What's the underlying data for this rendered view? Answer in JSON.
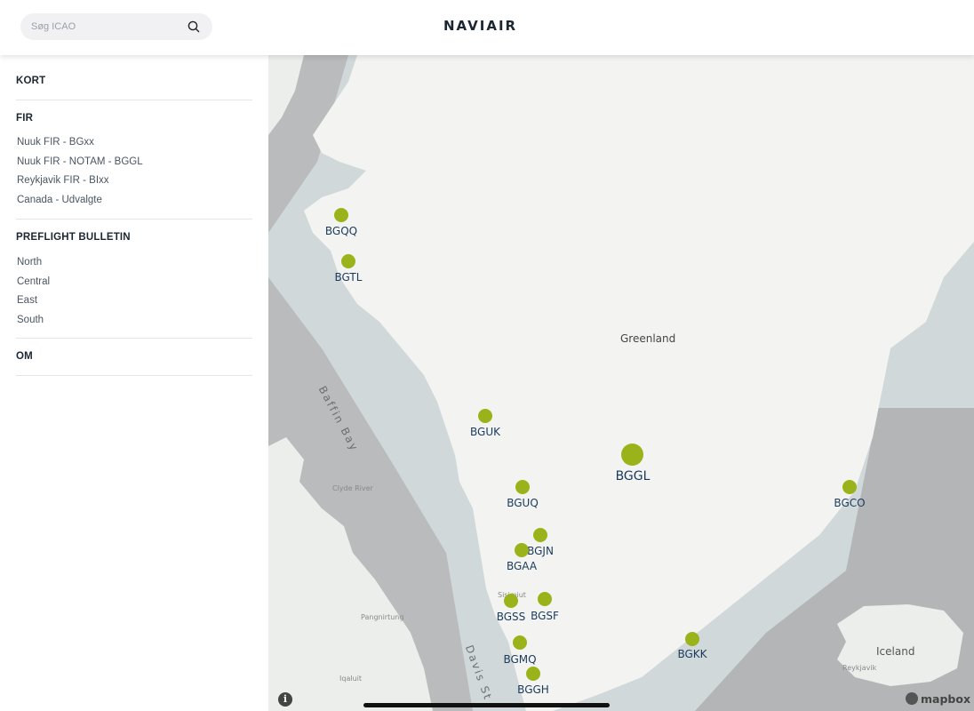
{
  "header": {
    "search_placeholder": "Søg ICAO",
    "logo": "NAVIAIR"
  },
  "sidebar": {
    "kort": "KORT",
    "fir": {
      "title": "FIR",
      "items": [
        "Nuuk FIR - BGxx",
        "Nuuk FIR - NOTAM - BGGL",
        "Reykjavik FIR - BIxx",
        "Canada - Udvalgte"
      ]
    },
    "preflight": {
      "title": "PREFLIGHT BULLETIN",
      "items": [
        "North",
        "Central",
        "East",
        "South"
      ]
    },
    "om": "OM"
  },
  "map": {
    "region_label": "Greenland",
    "sea_label": "Baffin Bay",
    "strait_label": "Davis St",
    "iceland_label": "Iceland",
    "place_labels": [
      "Clyde River",
      "Pangnirtung",
      "Iqaluit",
      "Sisimiut",
      "Reykjavik"
    ],
    "attribution": "mapbox",
    "info": "i",
    "airports": [
      "BGQQ",
      "BGTL",
      "BGUK",
      "BGGL",
      "BGUQ",
      "BGJN",
      "BGAA",
      "BGSS",
      "BGSF",
      "BGMQ",
      "BGGH",
      "BGKK",
      "BGCO"
    ]
  },
  "colors": {
    "marker": "#9bb31a",
    "label": "#1a3a5c",
    "land": "#f3f4f2",
    "water": "#d1d8d9",
    "outside_region": "#b3b5b6"
  }
}
